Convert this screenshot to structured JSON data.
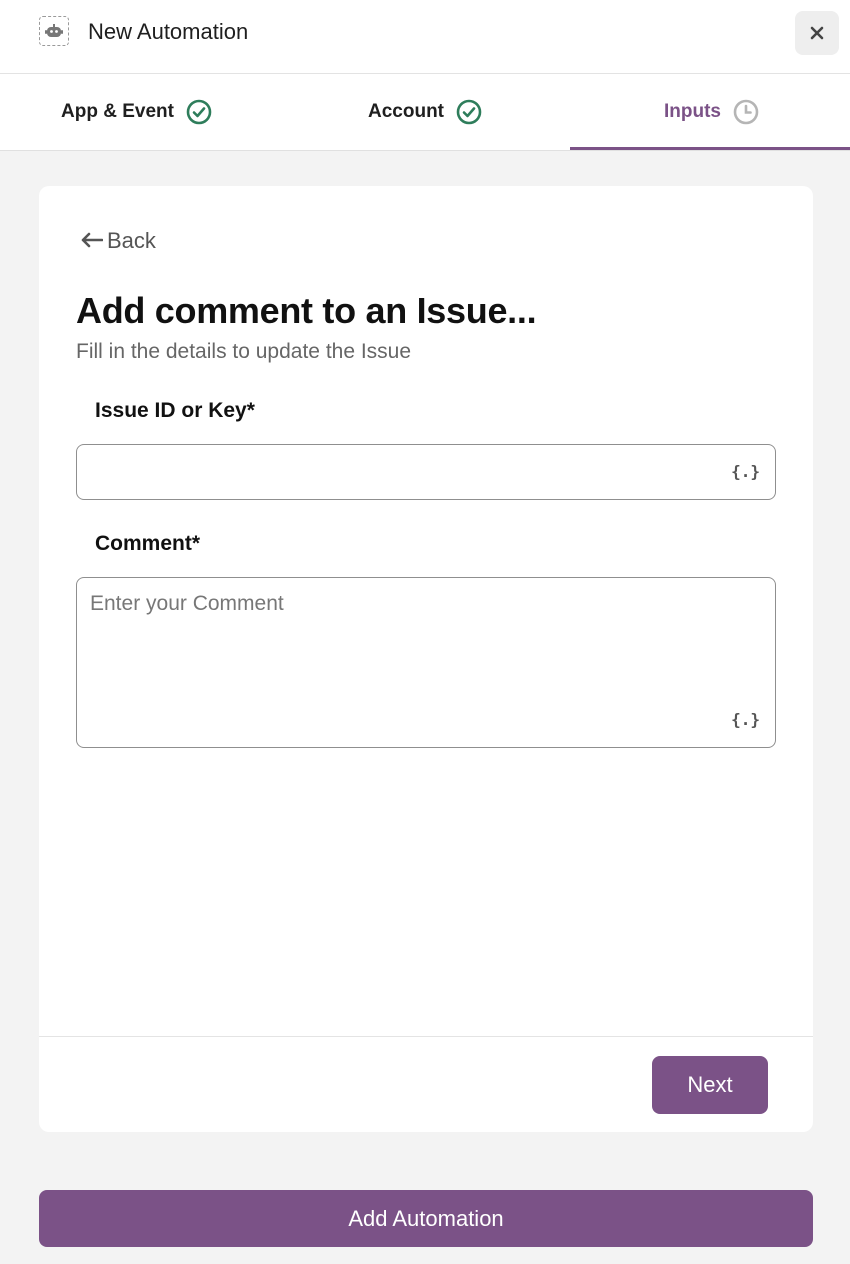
{
  "header": {
    "title": "New Automation",
    "app_icon": "robot-icon",
    "close_icon": "close-icon"
  },
  "tabs": [
    {
      "label": "App & Event",
      "status": "complete",
      "icon": "check-circle-icon"
    },
    {
      "label": "Account",
      "status": "complete",
      "icon": "check-circle-icon"
    },
    {
      "label": "Inputs",
      "status": "current",
      "icon": "clock-icon"
    }
  ],
  "form": {
    "back_label": "Back",
    "back_icon": "arrow-left-icon",
    "title": "Add comment to an Issue...",
    "subtitle": "Fill in the details to update the Issue",
    "fields": [
      {
        "label": "Issue ID or Key*",
        "value": "",
        "placeholder": "",
        "variable_icon_text": "{.}"
      },
      {
        "label": "Comment*",
        "value": "",
        "placeholder": "Enter your Comment",
        "variable_icon_text": "{.}"
      }
    ],
    "next_label": "Next"
  },
  "footer": {
    "add_label": "Add Automation"
  },
  "colors": {
    "accent": "#7b5287",
    "success": "#2e7d5b",
    "muted_icon": "#b5b5b5"
  }
}
